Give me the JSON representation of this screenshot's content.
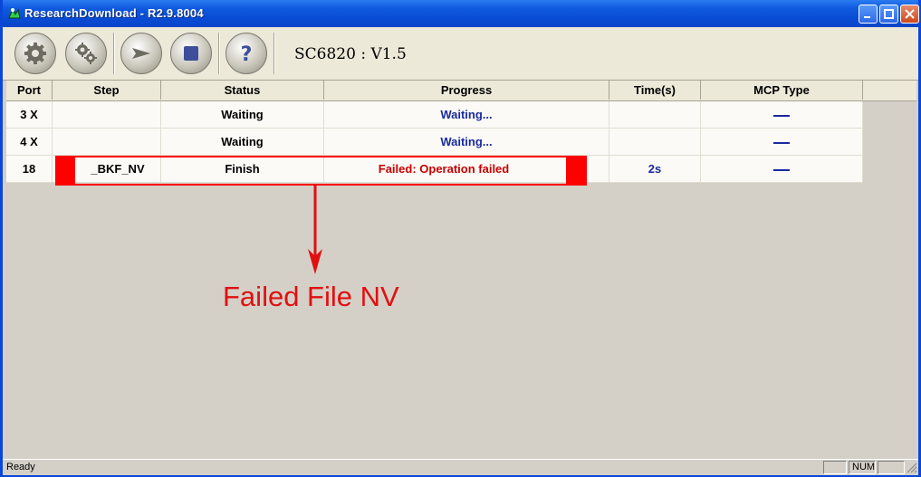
{
  "window": {
    "title": "ResearchDownload - R2.9.8004"
  },
  "toolbar": {
    "buttons": [
      {
        "icon": "gear-icon"
      },
      {
        "icon": "gears-icon"
      },
      {
        "icon": "play-icon"
      },
      {
        "icon": "stop-icon"
      },
      {
        "icon": "help-icon"
      }
    ],
    "version": "SC6820 : V1.5"
  },
  "table": {
    "columns": [
      "Port",
      "Step",
      "Status",
      "Progress",
      "Time(s)",
      "MCP Type"
    ],
    "rows": [
      {
        "port": "3",
        "port_mark": "X",
        "step": "",
        "status": "Waiting",
        "progress": "Waiting...",
        "time": "",
        "mcp": "dash"
      },
      {
        "port": "4",
        "port_mark": "X",
        "step": "",
        "status": "Waiting",
        "progress": "Waiting...",
        "time": "",
        "mcp": "dash"
      },
      {
        "port": "18",
        "port_mark": "",
        "step": "_BKF_NV",
        "status": "Finish",
        "progress": "Failed: Operation failed",
        "time": "2s",
        "mcp": "dash"
      }
    ]
  },
  "annotation": {
    "label": "Failed File NV",
    "color": "#e01010"
  },
  "statusbar": {
    "text": "Ready",
    "num": "NUM"
  },
  "colors": {
    "title_bar": "#0a4bd4",
    "failed": "#c80000",
    "waiting": "#1a2aa0",
    "highlight": "#ff0000"
  }
}
